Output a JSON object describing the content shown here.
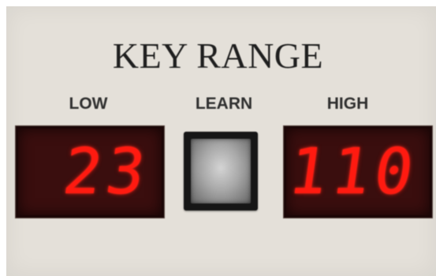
{
  "panel": {
    "title": "KEY RANGE"
  },
  "low": {
    "label": "LOW",
    "value": "23"
  },
  "learn": {
    "label": "LEARN"
  },
  "high": {
    "label": "HIGH",
    "value": "110"
  },
  "colors": {
    "panel_background": "#e4e0d9",
    "display_background": "#3a0e0e",
    "led_digits": "#ff1a10",
    "text": "#2f2f2f"
  }
}
